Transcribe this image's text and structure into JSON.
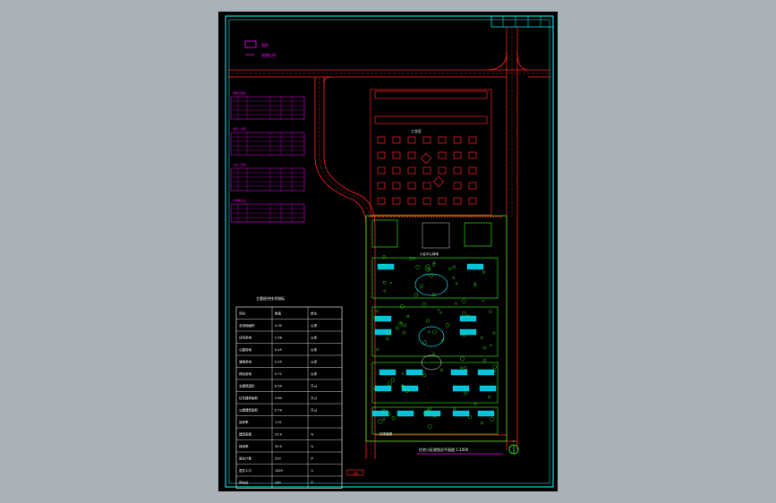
{
  "colors": {
    "background": "#aab1b9",
    "sheet": "#000000",
    "frame": "#00ffff",
    "road": "#ff2020",
    "building": "#ff2020",
    "site": "#39ff14",
    "magenta": "#ff00ff",
    "water": "#00e5ff",
    "text": "#ffffff"
  },
  "drawing": {
    "legend_symbol_a": "图例",
    "legend_symbol_b": "道路红线",
    "factory_label": "工业区",
    "site_label_upper": "小区中心绿地",
    "site_label_lower": "住宅组团",
    "plan_title": "住宅小区规划总平面图 1:1000",
    "table_title": "主要经济技术指标",
    "north_label": "N",
    "stamp": "签章"
  },
  "econ_table": {
    "headers": [
      "项目",
      "数值",
      "单位"
    ],
    "rows": [
      [
        "总用地面积",
        "4.30",
        "公顷"
      ],
      [
        "住宅用地",
        "2.58",
        "公顷"
      ],
      [
        "公建用地",
        "0.45",
        "公顷"
      ],
      [
        "道路用地",
        "0.55",
        "公顷"
      ],
      [
        "绿化用地",
        "0.72",
        "公顷"
      ],
      [
        "总建筑面积",
        "6.50",
        "万㎡"
      ],
      [
        "住宅建筑面积",
        "5.80",
        "万㎡"
      ],
      [
        "公建建筑面积",
        "0.70",
        "万㎡"
      ],
      [
        "容积率",
        "1.51",
        ""
      ],
      [
        "建筑密度",
        "25.0",
        "%"
      ],
      [
        "绿地率",
        "35.0",
        "%"
      ],
      [
        "居住户数",
        "520",
        "户"
      ],
      [
        "居住人口",
        "1820",
        "人"
      ],
      [
        "停车位",
        "260",
        "个"
      ]
    ]
  },
  "magenta_tables": [
    {
      "title": "用地平衡表",
      "rows": 5
    },
    {
      "title": "住宅一览表",
      "rows": 5
    },
    {
      "title": "公建一览表",
      "rows": 5
    },
    {
      "title": "户型统计表",
      "rows": 4
    }
  ]
}
